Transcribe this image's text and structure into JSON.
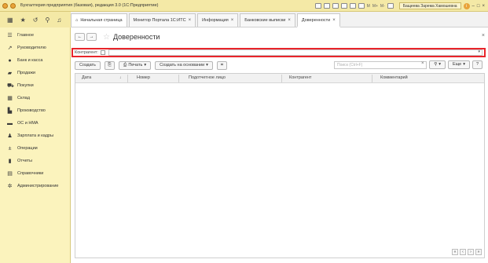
{
  "window": {
    "title": "Бухгалтерия предприятия (базовая), редакция 3.0  (1С:Предприятие)",
    "user": "Бащеева Зарема Хамошевна",
    "toolbar_counters": [
      "M",
      "M+",
      "M-"
    ]
  },
  "tabs": [
    {
      "label": "Начальная страница",
      "closable": false
    },
    {
      "label": "Монитор Портала 1С:ИТС",
      "closable": true
    },
    {
      "label": "Информация",
      "closable": true
    },
    {
      "label": "Банковские выписки",
      "closable": true
    },
    {
      "label": "Доверенности",
      "closable": true,
      "active": true
    }
  ],
  "sidebar": {
    "items": [
      {
        "label": "Главное",
        "icon": "menu-lines-icon"
      },
      {
        "label": "Руководителю",
        "icon": "trend-icon"
      },
      {
        "label": "Банк и касса",
        "icon": "coin-icon"
      },
      {
        "label": "Продажи",
        "icon": "bag-icon"
      },
      {
        "label": "Покупки",
        "icon": "cart-icon"
      },
      {
        "label": "Склад",
        "icon": "warehouse-icon"
      },
      {
        "label": "Производство",
        "icon": "factory-icon"
      },
      {
        "label": "ОС и НМА",
        "icon": "truck-icon"
      },
      {
        "label": "Зарплата и кадры",
        "icon": "people-icon"
      },
      {
        "label": "Операции",
        "icon": "operations-icon"
      },
      {
        "label": "Отчеты",
        "icon": "bar-chart-icon"
      },
      {
        "label": "Справочники",
        "icon": "book-icon"
      },
      {
        "label": "Администрирование",
        "icon": "gear-icon"
      }
    ]
  },
  "form": {
    "title": "Доверенности",
    "filter_label": "Контрагент:",
    "buttons": {
      "create": "Создать",
      "print": "Печать",
      "create_based_on": "Создать на основании",
      "more": "Еще",
      "help": "?"
    },
    "search_placeholder": "Поиск (Ctrl+F)",
    "columns": [
      "Дата",
      "Номер",
      "Подотчетное лицо",
      "Контрагент",
      "Комментарий"
    ]
  },
  "colors": {
    "sidebar_bg": "#fbf3bd",
    "titlebar_bg": "#f4e9a6",
    "highlight": "#e8252b"
  }
}
